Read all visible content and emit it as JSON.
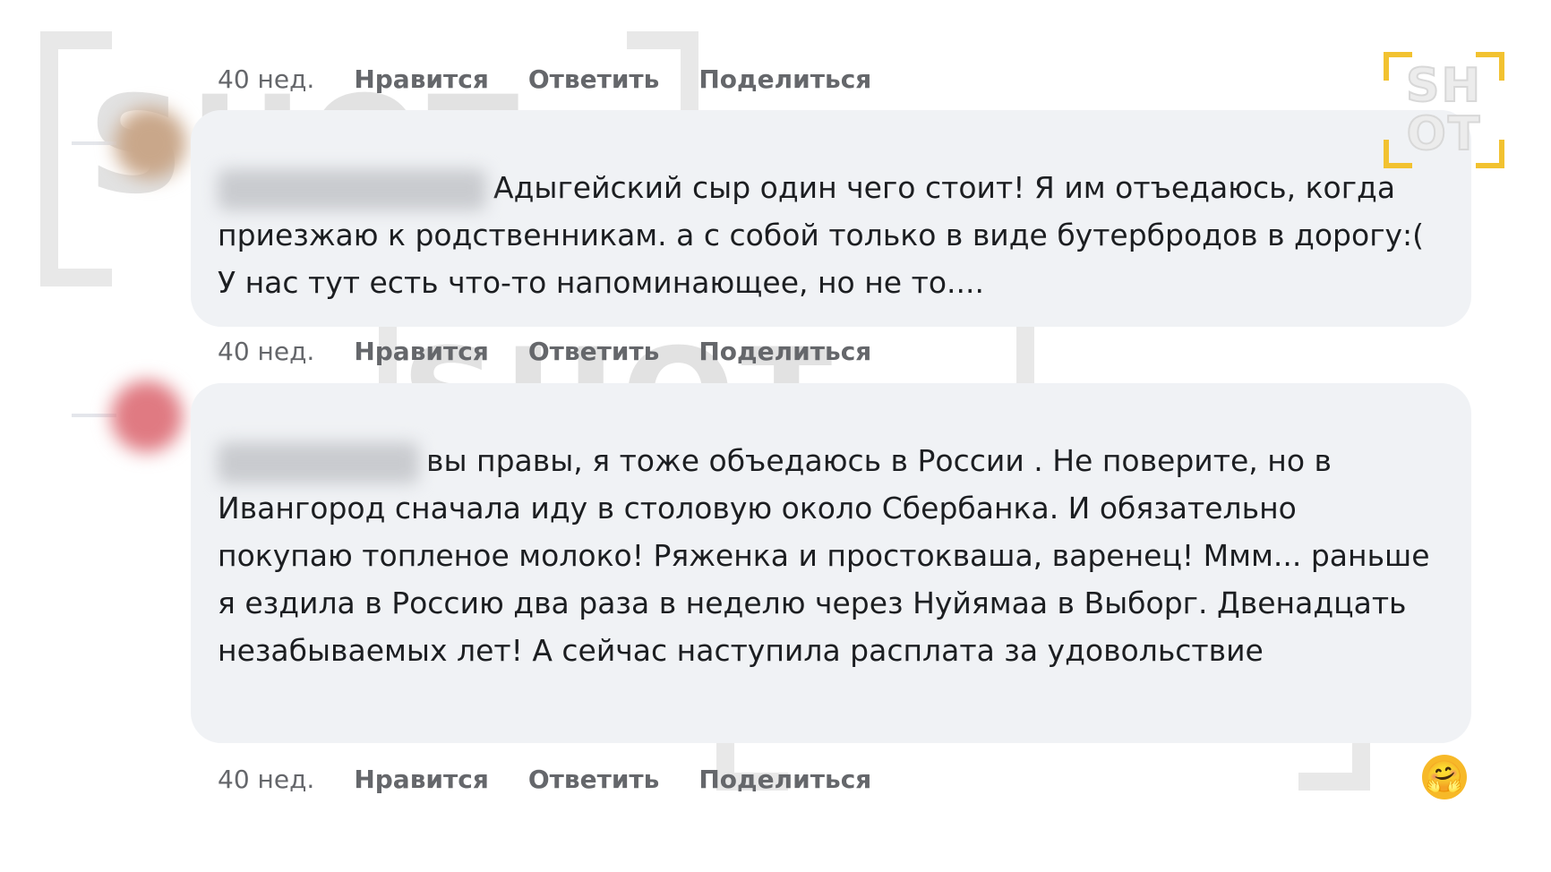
{
  "comments": [
    {
      "text": "Адыгейский сыр один чего стоит! Я им отъедаюсь, когда приезжаю к родственникам. а с собой только в виде бутербродов в дорогу:( У нас тут есть что-то напоминающее, но не то....",
      "actions": {
        "time": "40 нед.",
        "like": "Нравится",
        "reply": "Ответить",
        "share": "Поделиться"
      }
    },
    {
      "text": "вы правы, я тоже объедаюсь в России . Не поверите, но в Ивангород сначала иду в столовую около Сбербанка. И обязательно покупаю топленое молоко! Ряженка и простокваша, варенец! Ммм... раньше я ездила в Россию два раза в неделю через Нуйямаа в Выборг. Двенадцать незабываемых лет! А сейчас наступила расплата за удовольствие",
      "actions": {
        "time": "40 нед.",
        "like": "Нравится",
        "reply": "Ответить",
        "share": "Поделиться"
      }
    }
  ],
  "top_actions": {
    "time": "40 нед.",
    "like": "Нравится",
    "reply": "Ответить",
    "share": "Поделиться"
  },
  "reaction_icon": "care-emoji-icon",
  "watermark": {
    "text": "SHOT",
    "logo_line1": "SH",
    "logo_line2": "OT"
  },
  "colors": {
    "bubble": "#f0f2f5",
    "meta": "#65676b",
    "logo_bracket": "#f2c230"
  }
}
